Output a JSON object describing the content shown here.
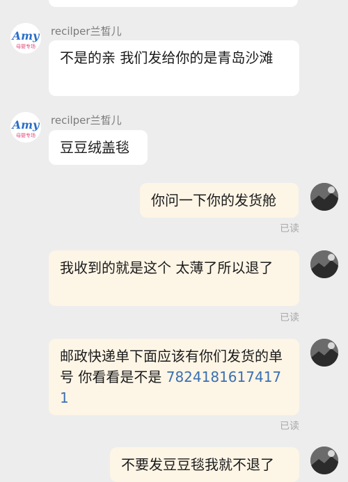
{
  "messages": [
    {
      "sender": "recilper兰皙儿",
      "text": "不是的亲 我们发给你的是青岛沙滩"
    },
    {
      "sender": "recilper兰皙儿",
      "text": "豆豆绒盖毯"
    },
    {
      "text": "你问一下你的发货舱",
      "status": "已读"
    },
    {
      "text": "我收到的就是这个 太薄了所以退了",
      "status": "已读"
    },
    {
      "text_prefix": "邮政快递单下面应该有你们发货的单号 你看看是不是 ",
      "tracking_number": "78241816174171",
      "status": "已读"
    },
    {
      "text": "不要发豆豆毯我就不退了"
    }
  ],
  "avatar_left": {
    "logo_text": "Amy",
    "sub_text": "母婴专场"
  },
  "colors": {
    "background": "#ededed",
    "incoming_bubble": "#ffffff",
    "outgoing_bubble": "#fdf5e6",
    "link": "#3a6fb0"
  }
}
